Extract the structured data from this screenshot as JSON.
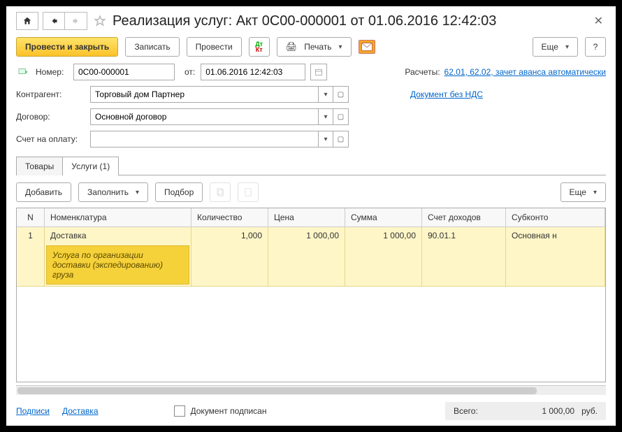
{
  "title": "Реализация услуг: Акт 0С00-000001 от 01.06.2016 12:42:03",
  "toolbar": {
    "post_close": "Провести и закрыть",
    "save": "Записать",
    "post": "Провести",
    "print": "Печать",
    "more": "Еще"
  },
  "header": {
    "number_label": "Номер:",
    "number": "0С00-000001",
    "date_label": "от:",
    "date": "01.06.2016 12:42:03",
    "settlements_label": "Расчеты:",
    "settlements_link": "62.01, 62.02, зачет аванса автоматически",
    "counterparty_label": "Контрагент:",
    "counterparty": "Торговый дом Партнер",
    "vat_link": "Документ без НДС",
    "contract_label": "Договор:",
    "contract": "Основной договор",
    "invoice_label": "Счет на оплату:",
    "invoice": ""
  },
  "tabs": {
    "goods": "Товары",
    "services": "Услуги (1)"
  },
  "subtoolbar": {
    "add": "Добавить",
    "fill": "Заполнить",
    "select": "Подбор",
    "more": "Еще"
  },
  "grid": {
    "headers": {
      "n": "N",
      "nom": "Номенклатура",
      "qty": "Количество",
      "price": "Цена",
      "sum": "Сумма",
      "acct": "Счет доходов",
      "sub": "Субконто"
    },
    "rows": [
      {
        "n": "1",
        "nom": "Доставка",
        "desc": "Услуга по организации доставки (экспедированию) груза",
        "qty": "1,000",
        "price": "1 000,00",
        "sum": "1 000,00",
        "acct": "90.01.1",
        "sub": "Основная н"
      }
    ]
  },
  "footer": {
    "signatures": "Подписи",
    "delivery": "Доставка",
    "signed_label": "Документ подписан",
    "total_label": "Всего:",
    "total_value": "1 000,00",
    "currency": "руб."
  }
}
